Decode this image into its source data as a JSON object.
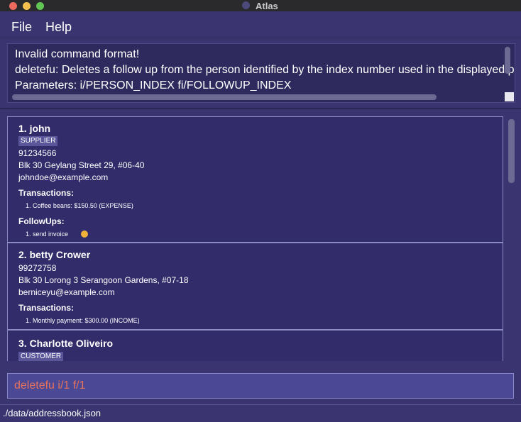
{
  "window": {
    "title": "Atlas"
  },
  "menu": {
    "file": "File",
    "help": "Help"
  },
  "result": {
    "line1": "Invalid command format!",
    "line2": "deletefu: Deletes a follow up from the person identified by the index number used in the displayed person list.",
    "line3": "Parameters: i/PERSON_INDEX fi/FOLLOWUP_INDEX"
  },
  "persons": [
    {
      "name": "1. john",
      "tag": "SUPPLIER",
      "phone": "91234566",
      "address": "Blk 30 Geylang Street 29, #06-40",
      "email": "johndoe@example.com",
      "transactions_label": "Transactions:",
      "transactions": [
        "1. Coffee beans: $150.50 (EXPENSE)"
      ],
      "followups_label": "FollowUps:",
      "followups": [
        "1. send invoice"
      ]
    },
    {
      "name": "2. betty Crower",
      "phone": "99272758",
      "address": "Blk 30 Lorong 3 Serangoon Gardens, #07-18",
      "email": "berniceyu@example.com",
      "transactions_label": "Transactions:",
      "transactions": [
        "1. Monthly payment: $300.00 (INCOME)"
      ]
    },
    {
      "name": "3. Charlotte Oliveiro",
      "tag": "CUSTOMER"
    }
  ],
  "command": {
    "value": "deletefu i/1 f/1"
  },
  "status": {
    "path": "./data/addressbook.json"
  }
}
